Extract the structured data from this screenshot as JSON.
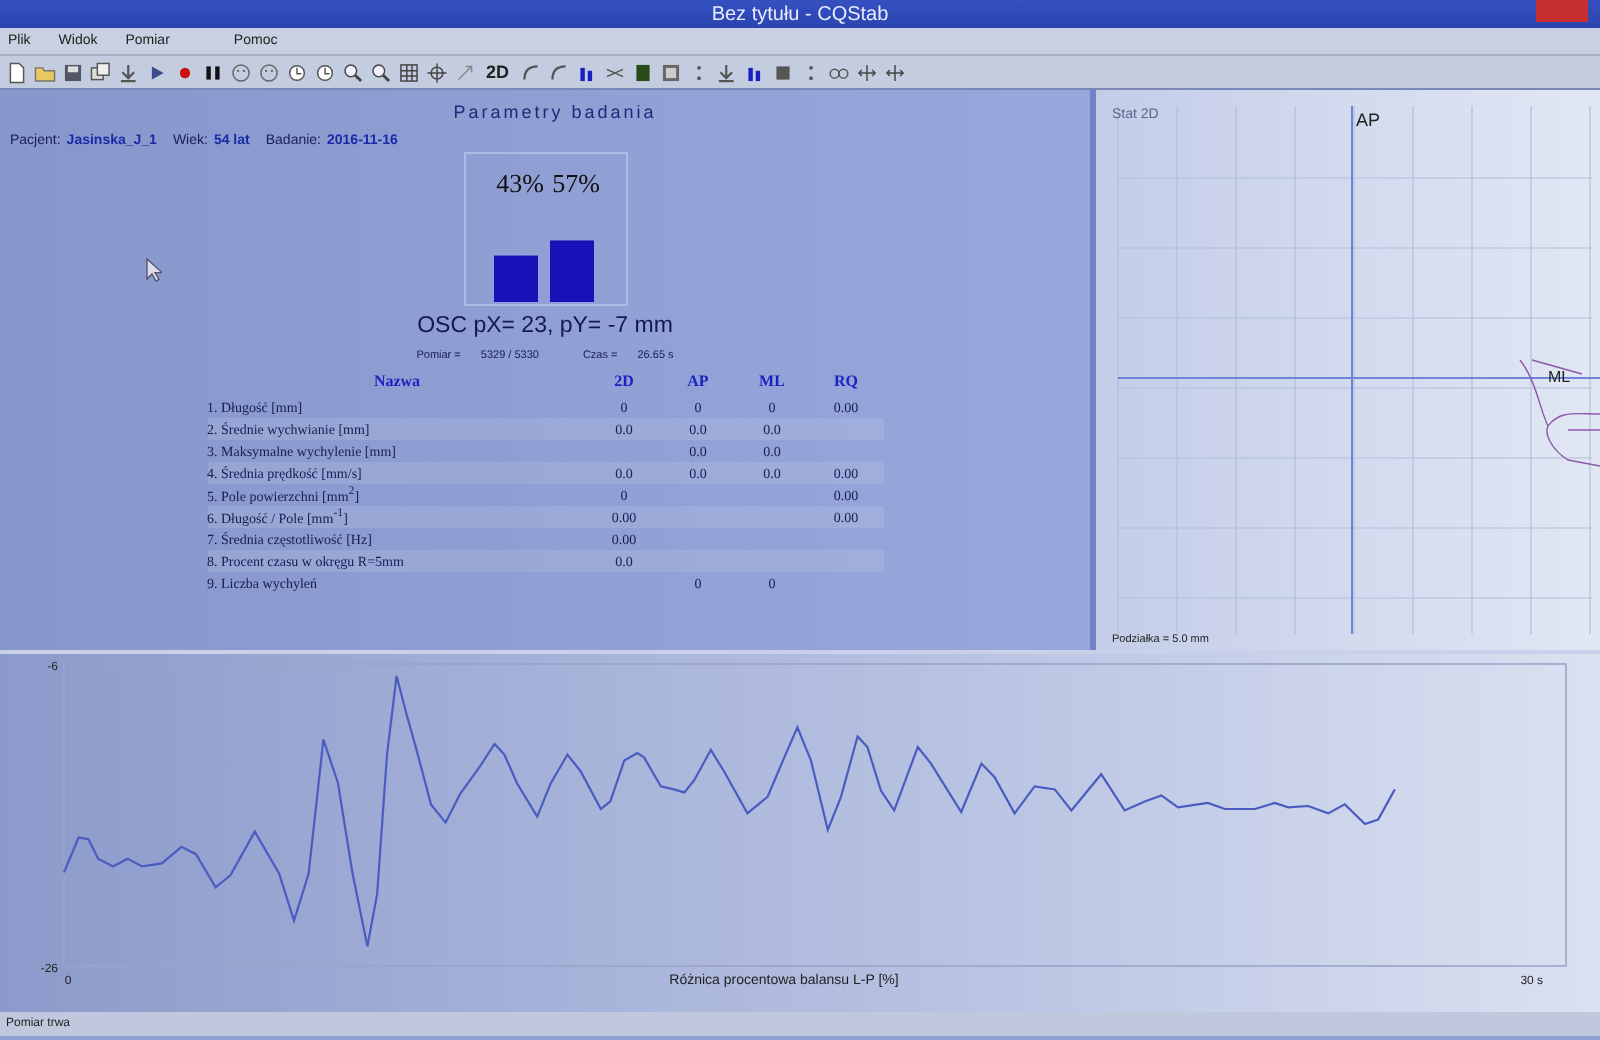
{
  "window": {
    "title": "Bez tytułu - CQStab"
  },
  "menu": [
    "Plik",
    "Widok",
    "Pomiar",
    "Pomoc"
  ],
  "toolbar": {
    "text_button": "2D"
  },
  "parameters": {
    "title": "Parametry badania",
    "patient": [
      {
        "label": "Pacjent:",
        "value": "Jasinska_J_1"
      },
      {
        "label": "Wiek:",
        "value": "54 lat"
      },
      {
        "label": "Badanie:",
        "value": "2016-11-16"
      }
    ],
    "balance_chart": {
      "chart_data": {
        "type": "bar",
        "values": [
          43,
          57
        ],
        "value_labels": [
          "43%",
          "57%"
        ],
        "color": "#1a10b8"
      }
    },
    "osc": "OSC pX= 23, pY= -7 mm",
    "readings": [
      {
        "label": "Pomiar =",
        "value": "5329 / 5330"
      },
      {
        "label": "Czas =",
        "value": "26.65 s"
      }
    ],
    "table": {
      "columns": [
        "Nazwa",
        "2D",
        "AP",
        "ML",
        "RQ"
      ],
      "rows": [
        {
          "name": "1. Długość [mm]",
          "c2d": "0",
          "ap": "0",
          "ml": "0",
          "rq": "0.00"
        },
        {
          "name": "2. Średnie wychwianie [mm]",
          "c2d": "0.0",
          "ap": "0.0",
          "ml": "0.0"
        },
        {
          "name": "3. Maksymalne wychylenie [mm]",
          "ap": "0.0",
          "ml": "0.0"
        },
        {
          "name": "4. Średnia prędkość [mm/s]",
          "c2d": "0.0",
          "ap": "0.0",
          "ml": "0.0",
          "rq": "0.00"
        },
        {
          "name": "5. Pole powierzchni [mm$^{2}$]",
          "c2d": "0",
          "rq": "0.00"
        },
        {
          "name": "6. Długość / Pole [mm$^{-1}$]",
          "c2d": "0.00",
          "rq": "0.00"
        },
        {
          "name": "7. Średnia częstotliwość [Hz]",
          "c2d": "0.00"
        },
        {
          "name": "8. Procent czasu w okręgu R=5mm",
          "c2d": "0.0"
        },
        {
          "name": "9. Liczba wychyleń",
          "ap": "0",
          "ml": "0"
        }
      ]
    }
  },
  "stat_2d": {
    "title": "Stat 2D",
    "axis_y": "AP",
    "axis_x": "ML",
    "scale": "Podziałka = 5.0 mm"
  },
  "balance_plot": {
    "chart_data": {
      "type": "line",
      "xlabel": "Różnica procentowa balansu L-P [%]",
      "xlim": [
        0,
        30.7
      ],
      "ylim": [
        -26,
        -6
      ],
      "xticks": [
        0,
        {
          "value": 30,
          "label": "30 s"
        }
      ],
      "yticks": [
        -6,
        -26
      ],
      "x": [
        0,
        0.3,
        0.5,
        0.7,
        1.0,
        1.3,
        1.6,
        2.0,
        2.4,
        2.7,
        3.1,
        3.4,
        3.9,
        4.4,
        4.7,
        5.0,
        5.3,
        5.6,
        5.9,
        6.2,
        6.4,
        6.6,
        6.8,
        7.0,
        7.2,
        7.5,
        7.8,
        8.1,
        8.5,
        8.8,
        9.0,
        9.26,
        9.67,
        9.95,
        10.29,
        10.56,
        10.97,
        11.17,
        11.45,
        11.72,
        11.86,
        12.2,
        12.47,
        12.68,
        12.88,
        13.22,
        13.49,
        13.97,
        14.38,
        14.72,
        14.99,
        15.27,
        15.61,
        15.88,
        16.22,
        16.42,
        16.7,
        16.97,
        17.45,
        17.72,
        18.34,
        18.75,
        19.02,
        19.43,
        19.84,
        20.25,
        20.59,
        21.2,
        21.68,
        22.09,
        22.43,
        22.77,
        23.38,
        23.73,
        24.34,
        24.75,
        25.02,
        25.43,
        25.84,
        26.18,
        26.59,
        26.86,
        27.2
      ],
      "series": [
        {
          "color": "#4a5cc0",
          "values": [
            -19.8,
            -17.5,
            -17.6,
            -18.9,
            -19.4,
            -18.9,
            -19.4,
            -19.2,
            -18.1,
            -18.6,
            -20.8,
            -20.0,
            -17.1,
            -19.9,
            -23.0,
            -19.9,
            -11.0,
            -13.9,
            -19.9,
            -24.7,
            -21.2,
            -12.0,
            -6.8,
            -9.3,
            -11.6,
            -15.3,
            -16.5,
            -14.6,
            -12.8,
            -11.3,
            -12.0,
            -13.9,
            -16.1,
            -13.9,
            -12.0,
            -13.1,
            -15.6,
            -15.1,
            -12.4,
            -11.9,
            -12.2,
            -14.1,
            -14.3,
            -14.5,
            -13.7,
            -11.7,
            -13.1,
            -15.9,
            -14.8,
            -12.2,
            -10.2,
            -12.4,
            -17.0,
            -14.8,
            -10.8,
            -11.5,
            -14.4,
            -15.7,
            -11.5,
            -12.6,
            -15.8,
            -12.6,
            -13.5,
            -15.9,
            -14.1,
            -14.3,
            -15.7,
            -13.3,
            -15.7,
            -15.1,
            -14.7,
            -15.5,
            -15.2,
            -15.6,
            -15.6,
            -15.2,
            -15.5,
            -15.4,
            -15.9,
            -15.3,
            -16.6,
            -16.3,
            -14.3
          ]
        }
      ]
    }
  },
  "status_bar": "Pomiar trwa"
}
